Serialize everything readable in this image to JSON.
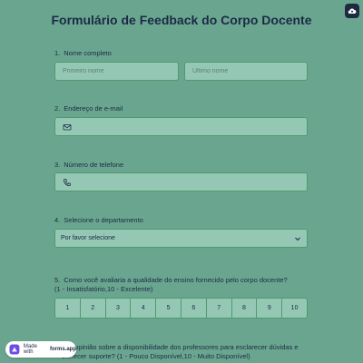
{
  "header": {
    "title": "Formulário de Feedback do Corpo Docente",
    "corner_icon": "cloud-icon"
  },
  "questions": [
    {
      "num": "1.",
      "label": "Nome completo"
    },
    {
      "num": "2.",
      "label": "Endereço de e-mail"
    },
    {
      "num": "3.",
      "label": "Número de telefone"
    },
    {
      "num": "4.",
      "label": "Selecione o departamento"
    },
    {
      "num": "5.",
      "label": "Como você avaliaria a qualidade do ensino fornecido pelo corpo docente? (1 - Insatisfatório,10 - Excelente)"
    },
    {
      "num": "",
      "label": "sua opinião sobre a disponibilidade dos professores para esclarecer dúvidas e oferecer suporte? (1 - Pouco Disponível,10 - Muito Disponível)"
    }
  ],
  "fields": {
    "first_name_placeholder": "Primeiro nome",
    "last_name_placeholder": "Último nome",
    "email_value": "",
    "phone_value": ""
  },
  "department": {
    "selected": "Por favor selecione"
  },
  "rating": [
    "1",
    "2",
    "3",
    "4",
    "5",
    "6",
    "7",
    "8",
    "9",
    "10"
  ],
  "badge": {
    "prefix": "Made with",
    "brand": "forms.app"
  },
  "colors": {
    "background": "#6aa68f",
    "field": "#94c8b4",
    "text": "#1b2a44"
  }
}
